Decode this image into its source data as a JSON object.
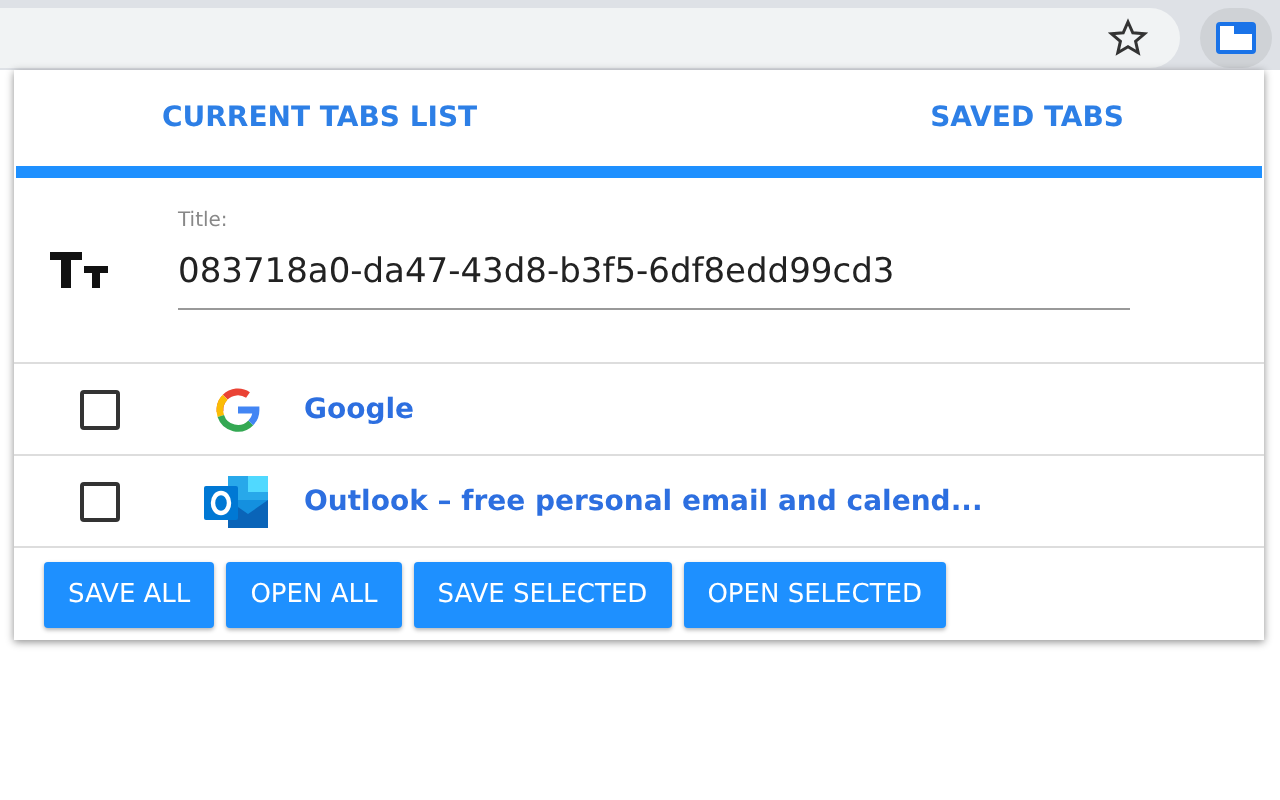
{
  "tabs": [
    {
      "label": "CURRENT TABS LIST"
    },
    {
      "label": "SAVED TABS"
    }
  ],
  "title_field": {
    "label": "Title:",
    "value": "083718a0-da47-43d8-b3f5-6df8edd99cd3"
  },
  "tab_rows": [
    {
      "kind": "google",
      "title": "Google",
      "checked": false
    },
    {
      "kind": "outlook",
      "title": "Outlook – free personal email and calend...",
      "checked": false
    }
  ],
  "buttons": [
    "SAVE ALL",
    "OPEN ALL",
    "SAVE SELECTED",
    "OPEN SELECTED"
  ]
}
